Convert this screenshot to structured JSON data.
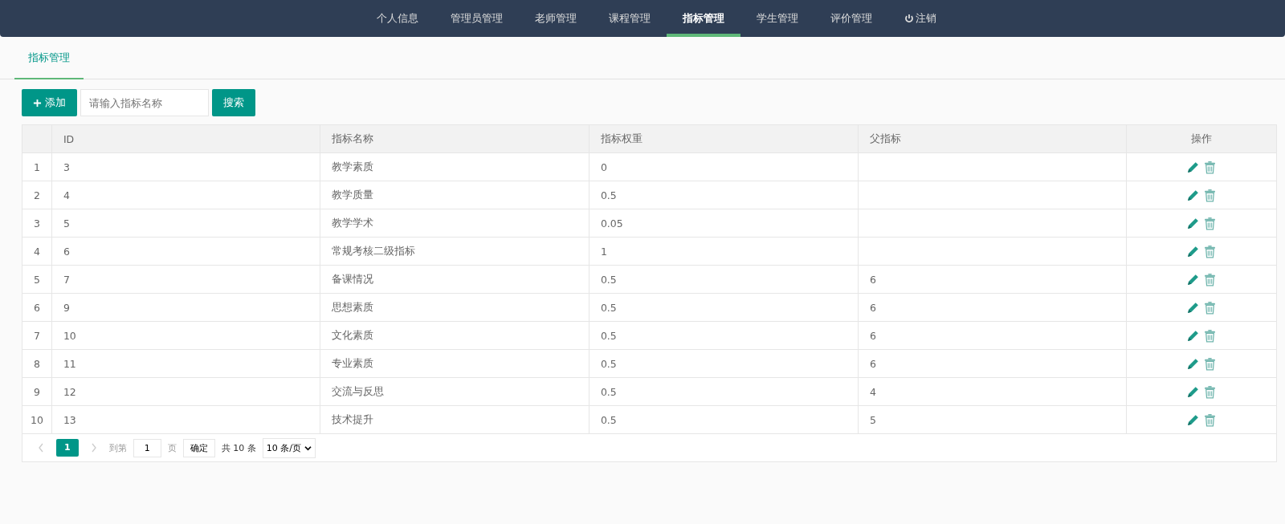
{
  "nav": [
    {
      "label": "个人信息",
      "selected": false,
      "kind": "link"
    },
    {
      "label": "管理员管理",
      "selected": false,
      "kind": "link"
    },
    {
      "label": "老师管理",
      "selected": false,
      "kind": "link"
    },
    {
      "label": "课程管理",
      "selected": false,
      "kind": "link"
    },
    {
      "label": "指标管理",
      "selected": true,
      "kind": "link"
    },
    {
      "label": "学生管理",
      "selected": false,
      "kind": "link"
    },
    {
      "label": "评价管理",
      "selected": false,
      "kind": "link"
    },
    {
      "label": "注销",
      "selected": false,
      "kind": "logout"
    }
  ],
  "tabs": [
    {
      "label": "指标管理",
      "selected": true
    }
  ],
  "toolbar": {
    "add_button": "添加",
    "search": {
      "placeholder": "请输入指标名称"
    },
    "search_button": "搜索"
  },
  "table": {
    "columns": [
      "",
      "ID",
      "指标名称",
      "指标权重",
      "父指标",
      "操作"
    ],
    "rows": [
      [
        "1",
        "3",
        "教学素质",
        "0",
        ""
      ],
      [
        "2",
        "4",
        "教学质量",
        "0.5",
        ""
      ],
      [
        "3",
        "5",
        "教学学术",
        "0.05",
        ""
      ],
      [
        "4",
        "6",
        "常规考核二级指标",
        "1",
        ""
      ],
      [
        "5",
        "7",
        "备课情况",
        "0.5",
        "6"
      ],
      [
        "6",
        "9",
        "思想素质",
        "0.5",
        "6"
      ],
      [
        "7",
        "10",
        "文化素质",
        "0.5",
        "6"
      ],
      [
        "8",
        "11",
        "专业素质",
        "0.5",
        "6"
      ],
      [
        "9",
        "12",
        "交流与反思",
        "0.5",
        "4"
      ],
      [
        "10",
        "13",
        "技术提升",
        "0.5",
        "5"
      ]
    ]
  },
  "pagination": {
    "pages": [
      {
        "label": "1",
        "selected": true
      }
    ],
    "goto_label": "到第",
    "goto_value": "1",
    "page_unit": "页",
    "confirm": "确定",
    "total": "共 10 条",
    "page_size": "10 条/页"
  }
}
